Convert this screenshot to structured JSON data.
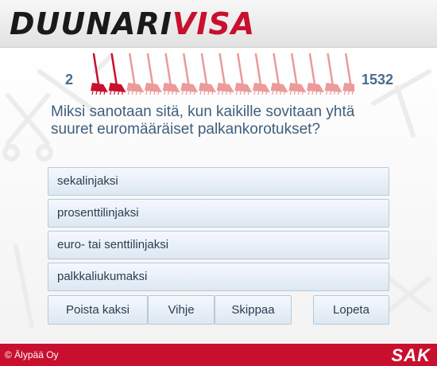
{
  "header": {
    "logo_part1": "DUUNARI",
    "logo_part2": "VISA"
  },
  "progress": {
    "current_score": "2",
    "max_score": "1532",
    "total_steps": 15,
    "completed_steps": 2,
    "colors": {
      "active": "#c8102e",
      "inactive": "#ec9a9a"
    }
  },
  "question": {
    "text": "Miksi sanotaan sitä, kun kaikille sovitaan yhtä suuret euromääräiset palkankorotukset?"
  },
  "answers": [
    {
      "label": "sekalinjaksi"
    },
    {
      "label": "prosenttilinjaksi"
    },
    {
      "label": "euro- tai senttilinjaksi"
    },
    {
      "label": "palkkaliukumaksi"
    }
  ],
  "buttons": {
    "remove_two": "Poista kaksi",
    "hint": "Vihje",
    "skip": "Skippaa",
    "quit": "Lopeta"
  },
  "footer": {
    "copyright": "© Älypää Oy",
    "brand": "SAK"
  }
}
